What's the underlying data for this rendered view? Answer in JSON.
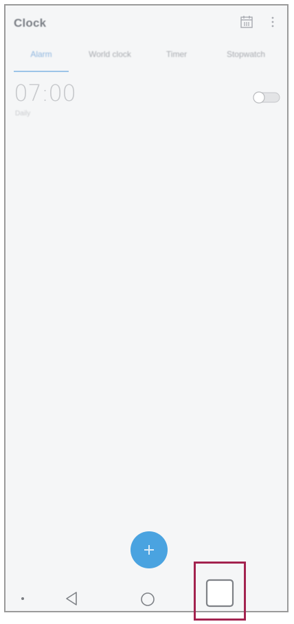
{
  "app": {
    "title": "Clock"
  },
  "icons": {
    "calendar": "calendar-icon",
    "more": "more-vert-icon",
    "add": "plus-icon",
    "back": "triangle-back-icon",
    "home": "circle-home-icon",
    "recents": "square-recents-icon"
  },
  "tabs": [
    {
      "label": "Alarm",
      "active": true
    },
    {
      "label": "World clock",
      "active": false
    },
    {
      "label": "Timer",
      "active": false
    },
    {
      "label": "Stopwatch",
      "active": false
    }
  ],
  "alarm": {
    "time": "07:00",
    "repeat": "Daily",
    "enabled": false
  },
  "colors": {
    "accent": "#4aa3e0",
    "highlight": "#a3234f"
  }
}
